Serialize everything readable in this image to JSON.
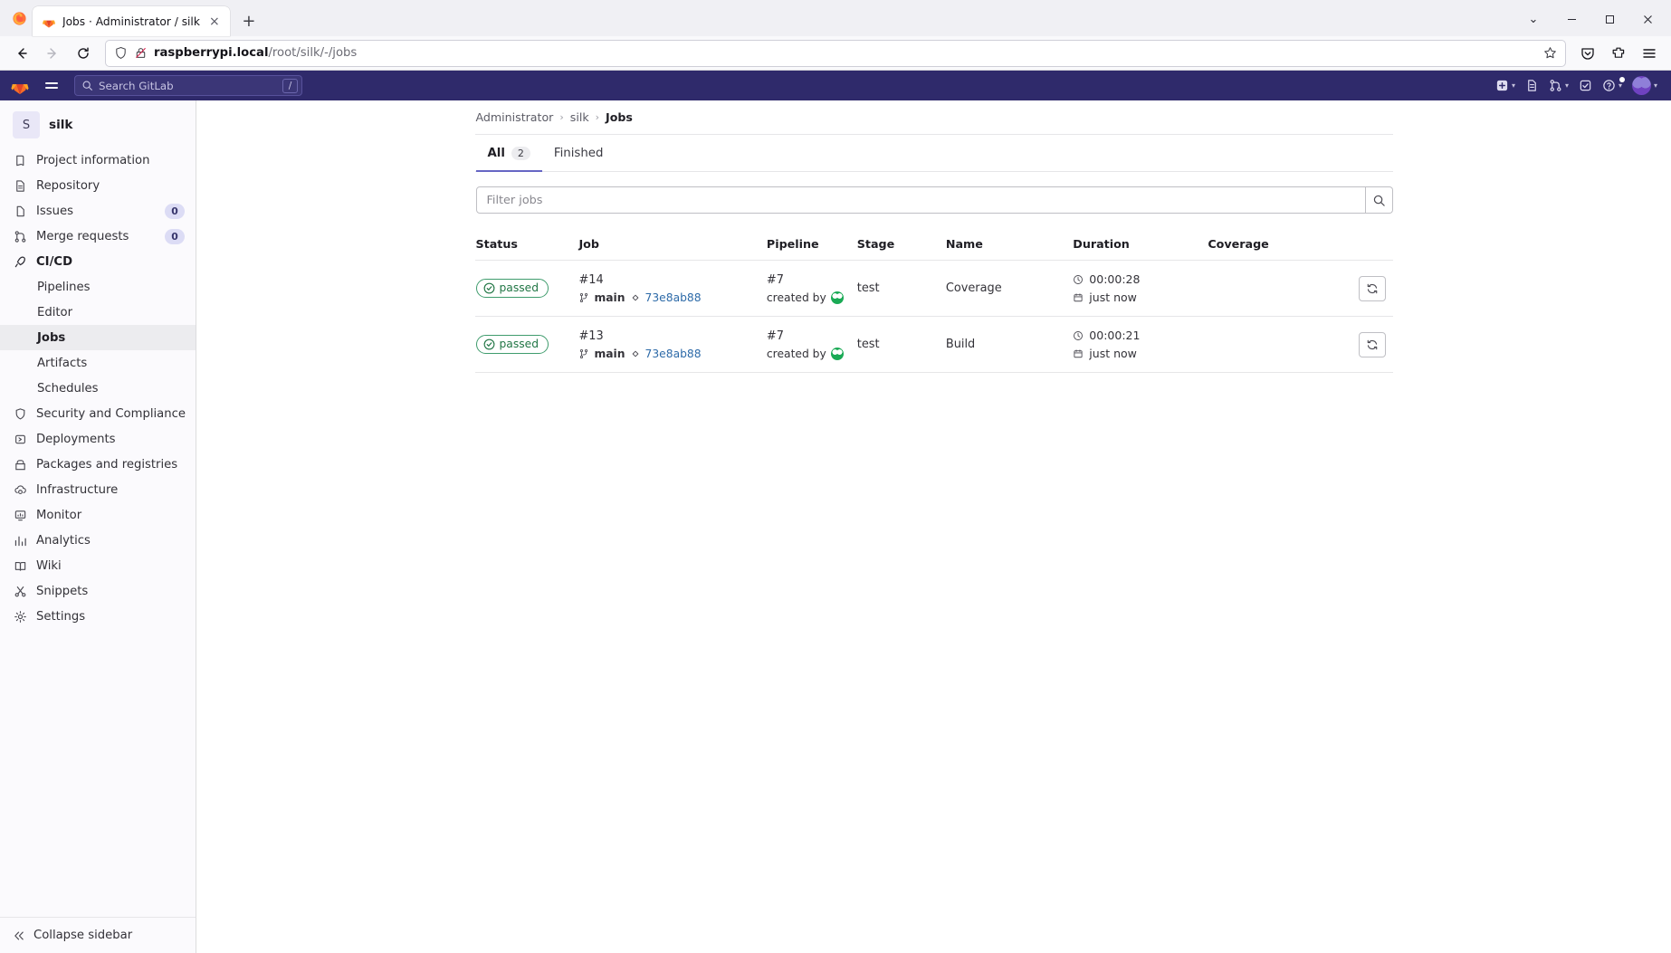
{
  "browser": {
    "tab": {
      "title": "Jobs · Administrator / silk",
      "favicon": "gitlab-favicon",
      "close_label": "×"
    },
    "newtab_label": "+",
    "window_controls": {
      "minimize": "—",
      "maximize": "❐",
      "close": "✕",
      "list_tabs": "⌄"
    },
    "nav": {
      "back": "←",
      "forward": "→",
      "reload": "↻"
    },
    "url": {
      "host": "raspberrypi.local",
      "path": "/root/silk/-/jobs"
    },
    "toolbar_icons": [
      "shield-icon",
      "lock-crossed-icon",
      "bookmark-star-icon",
      "pocket-icon",
      "extensions-icon",
      "menu-icon"
    ]
  },
  "topbar": {
    "logo": "gitlab-logo",
    "menu_label": "hamburger-menu",
    "search": {
      "placeholder": "Search GitLab",
      "shortcut": "/"
    },
    "actions": [
      {
        "name": "create-new-menu",
        "icon": "plus-square-icon",
        "caret": "⌄"
      },
      {
        "name": "issues-link",
        "icon": "issues-icon"
      },
      {
        "name": "merge-requests-menu",
        "icon": "merge-request-icon",
        "caret": "⌄"
      },
      {
        "name": "todos-link",
        "icon": "todo-check-icon"
      },
      {
        "name": "help-menu",
        "icon": "help-circle-icon",
        "caret": "⌄"
      },
      {
        "name": "user-menu",
        "icon": "user-avatar",
        "caret": "⌄"
      }
    ]
  },
  "sidebar": {
    "project": {
      "initial": "S",
      "name": "silk"
    },
    "items": [
      {
        "label": "Project information",
        "icon": "book-icon",
        "kind": "top"
      },
      {
        "label": "Repository",
        "icon": "file-doc-icon",
        "kind": "top"
      },
      {
        "label": "Issues",
        "icon": "issue-icon",
        "kind": "top",
        "badge": "0"
      },
      {
        "label": "Merge requests",
        "icon": "merge-icon",
        "kind": "top",
        "badge": "0"
      },
      {
        "label": "CI/CD",
        "icon": "rocket-icon",
        "kind": "section"
      },
      {
        "label": "Pipelines",
        "icon": "",
        "kind": "sub"
      },
      {
        "label": "Editor",
        "icon": "",
        "kind": "sub"
      },
      {
        "label": "Jobs",
        "icon": "",
        "kind": "sub",
        "active": true
      },
      {
        "label": "Artifacts",
        "icon": "",
        "kind": "sub"
      },
      {
        "label": "Schedules",
        "icon": "",
        "kind": "sub"
      },
      {
        "label": "Security and Compliance",
        "icon": "shield-icon",
        "kind": "top"
      },
      {
        "label": "Deployments",
        "icon": "deploy-icon",
        "kind": "top"
      },
      {
        "label": "Packages and registries",
        "icon": "package-icon",
        "kind": "top"
      },
      {
        "label": "Infrastructure",
        "icon": "cloud-gear-icon",
        "kind": "top"
      },
      {
        "label": "Monitor",
        "icon": "monitor-icon",
        "kind": "top"
      },
      {
        "label": "Analytics",
        "icon": "chart-icon",
        "kind": "top"
      },
      {
        "label": "Wiki",
        "icon": "book-open-icon",
        "kind": "top"
      },
      {
        "label": "Snippets",
        "icon": "scissors-icon",
        "kind": "top"
      },
      {
        "label": "Settings",
        "icon": "gear-icon",
        "kind": "top"
      }
    ],
    "collapse": {
      "label": "Collapse sidebar",
      "icon": "chevron-double-left-icon"
    }
  },
  "main": {
    "breadcrumb": [
      {
        "label": "Administrator",
        "current": false
      },
      {
        "label": "silk",
        "current": false
      },
      {
        "label": "Jobs",
        "current": true
      }
    ],
    "breadcrumb_separator": "›",
    "tabs": [
      {
        "label": "All",
        "count": "2",
        "active": true
      },
      {
        "label": "Finished",
        "count": "",
        "active": false
      }
    ],
    "filter": {
      "placeholder": "Filter jobs",
      "value": "",
      "search_icon": "search-icon"
    },
    "table": {
      "headers": [
        "Status",
        "Job",
        "Pipeline",
        "Stage",
        "Name",
        "Duration",
        "Coverage",
        ""
      ],
      "rows": [
        {
          "status": "passed",
          "status_icon": "status-success-icon",
          "job_id": "#14",
          "branch": "main",
          "branch_icon": "branch-icon",
          "commit_icon": "commit-icon",
          "sha": "73e8ab88",
          "pipeline_id": "#7",
          "pipeline_by": "created by",
          "pipeline_avatar": "user-avatar",
          "stage": "test",
          "name": "Coverage",
          "duration": "00:00:28",
          "duration_icon": "clock-icon",
          "finished": "just now",
          "finished_icon": "calendar-icon",
          "coverage": "",
          "action": "retry-button",
          "action_icon": "retry-icon"
        },
        {
          "status": "passed",
          "status_icon": "status-success-icon",
          "job_id": "#13",
          "branch": "main",
          "branch_icon": "branch-icon",
          "commit_icon": "commit-icon",
          "sha": "73e8ab88",
          "pipeline_id": "#7",
          "pipeline_by": "created by",
          "pipeline_avatar": "user-avatar",
          "stage": "test",
          "name": "Build",
          "duration": "00:00:21",
          "duration_icon": "clock-icon",
          "finished": "just now",
          "finished_icon": "calendar-icon",
          "coverage": "",
          "action": "retry-button",
          "action_icon": "retry-icon"
        }
      ]
    }
  },
  "colors": {
    "gitlab_navy": "#2f2a6b",
    "accent_purple": "#6666c4",
    "success_green": "#217645",
    "link_blue": "#2d6aa8"
  }
}
